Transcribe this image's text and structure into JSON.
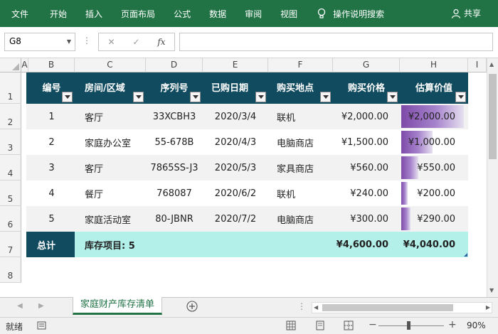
{
  "ribbon": {
    "tabs": [
      "文件",
      "开始",
      "插入",
      "页面布局",
      "公式",
      "数据",
      "审阅",
      "视图"
    ],
    "tell_me": "操作说明搜索",
    "share": "共享"
  },
  "formula_bar": {
    "name_box": "G8",
    "cancel_icon": "✕",
    "enter_icon": "✓",
    "fx_label": "fx",
    "formula": ""
  },
  "columns": [
    "A",
    "B",
    "C",
    "D",
    "E",
    "F",
    "G",
    "H",
    "I"
  ],
  "rows": [
    "1",
    "2",
    "3",
    "4",
    "5",
    "6",
    "7",
    "8"
  ],
  "table": {
    "headers": [
      "编号",
      "房间/区域",
      "序列号",
      "已购日期",
      "购买地点",
      "购买价格",
      "估算价值"
    ],
    "rows": [
      {
        "id": "1",
        "room": "客厅",
        "serial": "33XCBH3",
        "date": "2020/3/4",
        "place": "联机",
        "price": "¥2,000.00",
        "value": "¥2,000.00",
        "value_num": 2000
      },
      {
        "id": "2",
        "room": "家庭办公室",
        "serial": "55-678B",
        "date": "2020/4/3",
        "place": "电脑商店",
        "price": "¥1,500.00",
        "value": "¥1,000.00",
        "value_num": 1000
      },
      {
        "id": "3",
        "room": "客厅",
        "serial": "7865SS-J3",
        "date": "2020/5/3",
        "place": "家具商店",
        "price": "¥560.00",
        "value": "¥550.00",
        "value_num": 550
      },
      {
        "id": "4",
        "room": "餐厅",
        "serial": "768087",
        "date": "2020/6/2",
        "place": "联机",
        "price": "¥240.00",
        "value": "¥200.00",
        "value_num": 200
      },
      {
        "id": "5",
        "room": "家庭活动室",
        "serial": "80-JBNR",
        "date": "2020/7/2",
        "place": "电脑商店",
        "price": "¥300.00",
        "value": "¥290.00",
        "value_num": 290
      }
    ],
    "total": {
      "label": "总计",
      "items": "库存项目: 5",
      "price": "¥4,600.00",
      "value": "¥4,040.00"
    }
  },
  "sheet_tab": "家庭财产库存清单",
  "status": {
    "ready": "就绪",
    "zoom": "90%"
  },
  "colors": {
    "ribbon": "#217346",
    "header_fill": "#114b5f",
    "total_fill": "#b3f0ea",
    "databar": "#7d4aa8"
  }
}
